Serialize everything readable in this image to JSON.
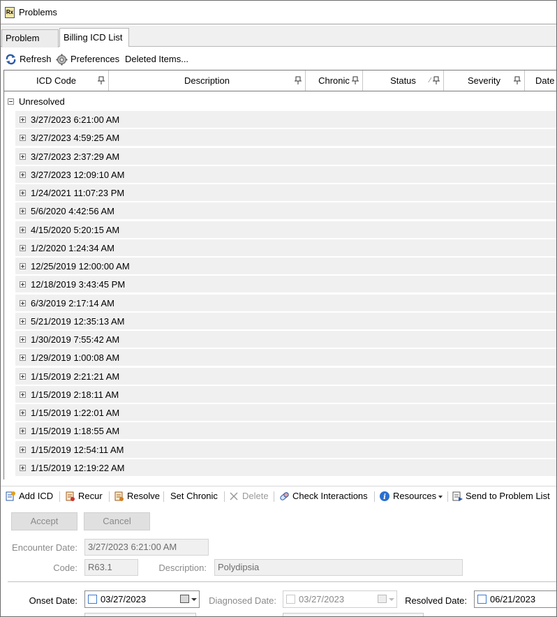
{
  "window": {
    "title": "Problems"
  },
  "tabs": [
    "Problem List",
    "Billing ICD List"
  ],
  "toolbar": {
    "refresh": "Refresh",
    "preferences": "Preferences",
    "deleted_items": "Deleted Items..."
  },
  "grid": {
    "columns": [
      "ICD Code",
      "Description",
      "Chronic",
      "Status",
      "Severity",
      "Date"
    ],
    "group_label": "Unresolved",
    "rows": [
      "3/27/2023 6:21:00 AM",
      "3/27/2023 4:59:25 AM",
      "3/27/2023 2:37:29 AM",
      "3/27/2023 12:09:10 AM",
      "1/24/2021 11:07:23 PM",
      "5/6/2020 4:42:56 AM",
      "4/15/2020 5:20:15 AM",
      "1/2/2020 1:24:34 AM",
      "12/25/2019 12:00:00 AM",
      "12/18/2019 3:43:45 PM",
      "6/3/2019 2:17:14 AM",
      "5/21/2019 12:35:13 AM",
      "1/30/2019 7:55:42 AM",
      "1/29/2019 1:00:08 AM",
      "1/15/2019 2:21:21 AM",
      "1/15/2019 2:18:11 AM",
      "1/15/2019 1:22:01 AM",
      "1/15/2019 1:18:55 AM",
      "1/15/2019 12:54:11 AM",
      "1/15/2019 12:19:22 AM"
    ]
  },
  "actions": {
    "add_icd": "Add ICD",
    "recur": "Recur",
    "resolve": "Resolve",
    "set_chronic": "Set Chronic",
    "delete": "Delete",
    "check_interactions": "Check Interactions",
    "resources": "Resources",
    "send_to_problem_list": "Send to Problem List"
  },
  "buttons": {
    "accept": "Accept",
    "cancel": "Cancel"
  },
  "form": {
    "encounter_date_label": "Encounter Date:",
    "encounter_date_value": "3/27/2023 6:21:00 AM",
    "code_label": "Code:",
    "code_value": "R63.1",
    "description_label": "Description:",
    "description_value": "Polydipsia",
    "onset_date_label": "Onset Date:",
    "onset_date_value": "03/27/2023",
    "diagnosed_date_label": "Diagnosed Date:",
    "diagnosed_date_value": "03/27/2023",
    "resolved_date_label": "Resolved Date:",
    "resolved_date_value": "06/21/2023"
  },
  "colors": {
    "accent_blue": "#3c7bd0",
    "row_background": "#f0f0f0",
    "disabled_text": "#8a8a8a"
  }
}
